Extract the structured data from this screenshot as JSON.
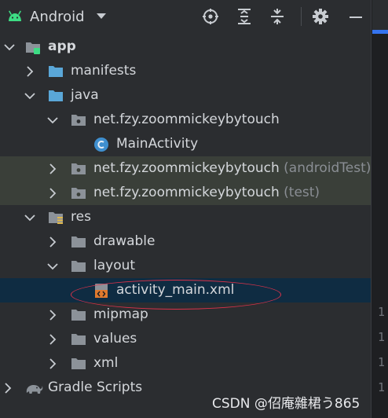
{
  "toolbar": {
    "view_label": "Android",
    "icons": [
      "android-icon",
      "chevron-down-icon",
      "locate-icon",
      "expand-all-icon",
      "collapse-all-icon",
      "gear-icon",
      "minimize-icon"
    ]
  },
  "colors": {
    "panel_bg": "#2b2d30",
    "selected_bg": "#0f2c42",
    "test_bg": "#3a3f39",
    "android_green": "#3ddc84",
    "folder_blue": "#5aa7d8",
    "class_blue": "#3f8fcf",
    "highlight_red": "#d9324a"
  },
  "tree": {
    "app": "app",
    "manifests": "manifests",
    "java": "java",
    "package_main": "net.fzy.zoommickeybytouch",
    "main_activity": "MainActivity",
    "package_android_test": "net.fzy.zoommickeybytouch",
    "android_test_suffix": "(androidTest)",
    "package_test": "net.fzy.zoommickeybytouch",
    "test_suffix": "(test)",
    "res": "res",
    "drawable": "drawable",
    "layout": "layout",
    "activity_main": "activity_main.xml",
    "mipmap": "mipmap",
    "values": "values",
    "xml": "xml",
    "gradle_scripts": "Gradle Scripts"
  },
  "editor_edge": {
    "line_numbers": [
      "1",
      "1",
      "1",
      "1"
    ]
  },
  "watermark": "CSDN @佋庵雜桾う865"
}
